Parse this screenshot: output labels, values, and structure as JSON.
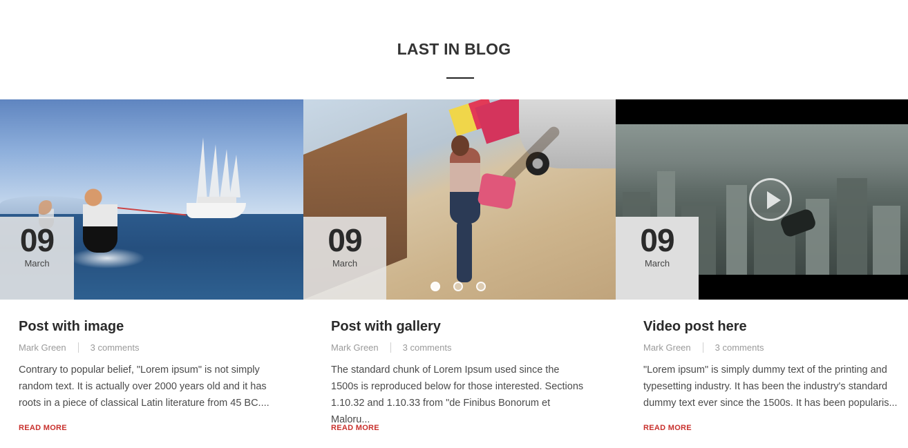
{
  "section": {
    "title": "LAST IN BLOG"
  },
  "posts": [
    {
      "day": "09",
      "month": "March",
      "title": "Post with image",
      "author": "Mark Green",
      "comments": "3 comments",
      "excerpt": "Contrary to popular belief, \"Lorem ipsum\" is not simply random text. It is actually over 2000 years old and it has roots in a piece of classical Latin literature from 45 BC....",
      "read_more": "READ MORE"
    },
    {
      "day": "09",
      "month": "March",
      "title": "Post with gallery",
      "author": "Mark Green",
      "comments": "3 comments",
      "excerpt": "The standard chunk of Lorem Ipsum used since the 1500s is reproduced below for those interested. Sections 1.10.32 and 1.10.33 from \"de Finibus Bonorum et Maloru...",
      "read_more": "READ MORE",
      "gallery": {
        "slides": 3,
        "active": 1
      }
    },
    {
      "day": "09",
      "month": "March",
      "title": "Video post here",
      "author": "Mark Green",
      "comments": "3 comments",
      "excerpt": "\"Lorem ipsum\" is simply dummy text of the printing and typesetting industry. It has been the industry's standard dummy text ever since the 1500s. It has been popularis...",
      "read_more": "READ MORE"
    }
  ],
  "icons": {
    "video": "play-icon"
  },
  "colors": {
    "accent": "#c8302c",
    "heading": "#2a2a2a",
    "meta": "#9a9a9a",
    "badge_bg": "#e6e6e6"
  }
}
